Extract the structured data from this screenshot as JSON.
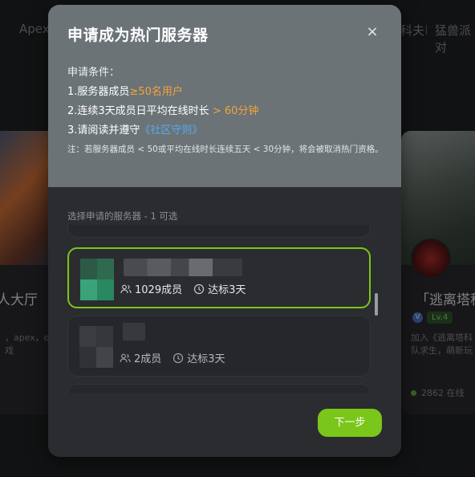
{
  "background": {
    "nav": [
      "Apex",
      "科夫",
      "猛兽派对"
    ],
    "left_card": {
      "title": "人大厅",
      "desc_lines": [
        "，apex，o",
        "戏"
      ]
    },
    "right_card": {
      "title": "「逃离塔科",
      "badge": "Lv.4",
      "verified": "V",
      "desc_lines": [
        "加入《逃离塔科",
        "队求生，萌新玩"
      ],
      "online": "2862 在线"
    }
  },
  "modal": {
    "title": "申请成为热门服务器",
    "close": "×",
    "conditions_heading": "申请条件：",
    "conditions": [
      {
        "prefix": "1.服务器成员",
        "highlight": "≥50名用户"
      },
      {
        "prefix": "2.连续3天成员日平均在线时长",
        "highlight": " > 60分钟"
      },
      {
        "prefix": "3.请阅读并遵守",
        "link": "《社区守则》"
      }
    ],
    "note": "注：若服务器成员 < 50或平均在线时长连续五天 < 30分钟，将会被取消热门资格。",
    "select_label": "选择申请的服务器 - 1 可选",
    "servers": [
      {
        "members": "1029成员",
        "status": "达标3天",
        "selected": true
      },
      {
        "members": "2成员",
        "status": "达标3天",
        "selected": false
      }
    ],
    "next_button": "下一步"
  },
  "colors": {
    "accent": "#7bc61a",
    "highlight": "#f2a43a",
    "link": "#5aa8f0",
    "modal_header": "#6b7377",
    "modal_body": "#2b2c30"
  }
}
